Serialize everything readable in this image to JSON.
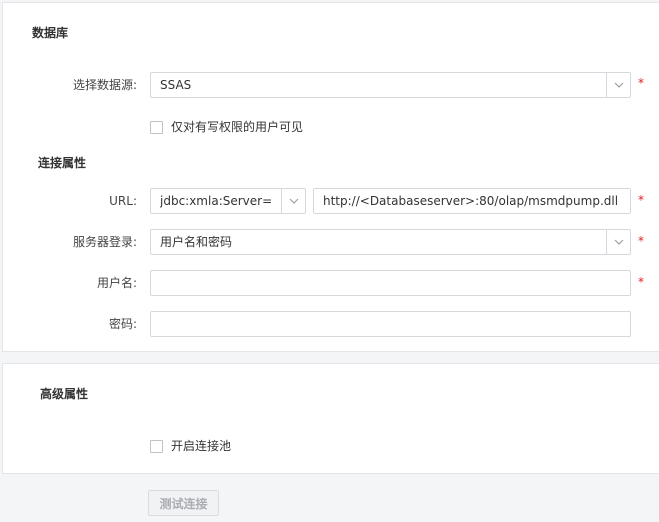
{
  "database_section": {
    "title": "数据库",
    "datasource": {
      "label": "选择数据源:",
      "value": "SSAS",
      "required": "*"
    },
    "write_only_checkbox": {
      "label": "仅对有写权限的用户可见",
      "checked": false
    }
  },
  "connection_section": {
    "title": "连接属性",
    "url": {
      "label": "URL:",
      "driver_value": "jdbc:xmla:Server=",
      "address_value": "http://<Databaseserver>:80/olap/msmdpump.dll",
      "required": "*"
    },
    "server_login": {
      "label": "服务器登录:",
      "value": "用户名和密码",
      "required": "*"
    },
    "username": {
      "label": "用户名:",
      "value": "",
      "required": "*"
    },
    "password": {
      "label": "密码:",
      "value": ""
    }
  },
  "advanced_section": {
    "title": "高级属性",
    "connection_pool_checkbox": {
      "label": "开启连接池",
      "checked": false
    }
  },
  "actions": {
    "test_connection_label": "测试连接"
  },
  "icons": {
    "dropdown": "chevron-down-icon"
  },
  "colors": {
    "required": "#e02020",
    "border": "#d5d8dc",
    "background": "#f4f5f7"
  }
}
